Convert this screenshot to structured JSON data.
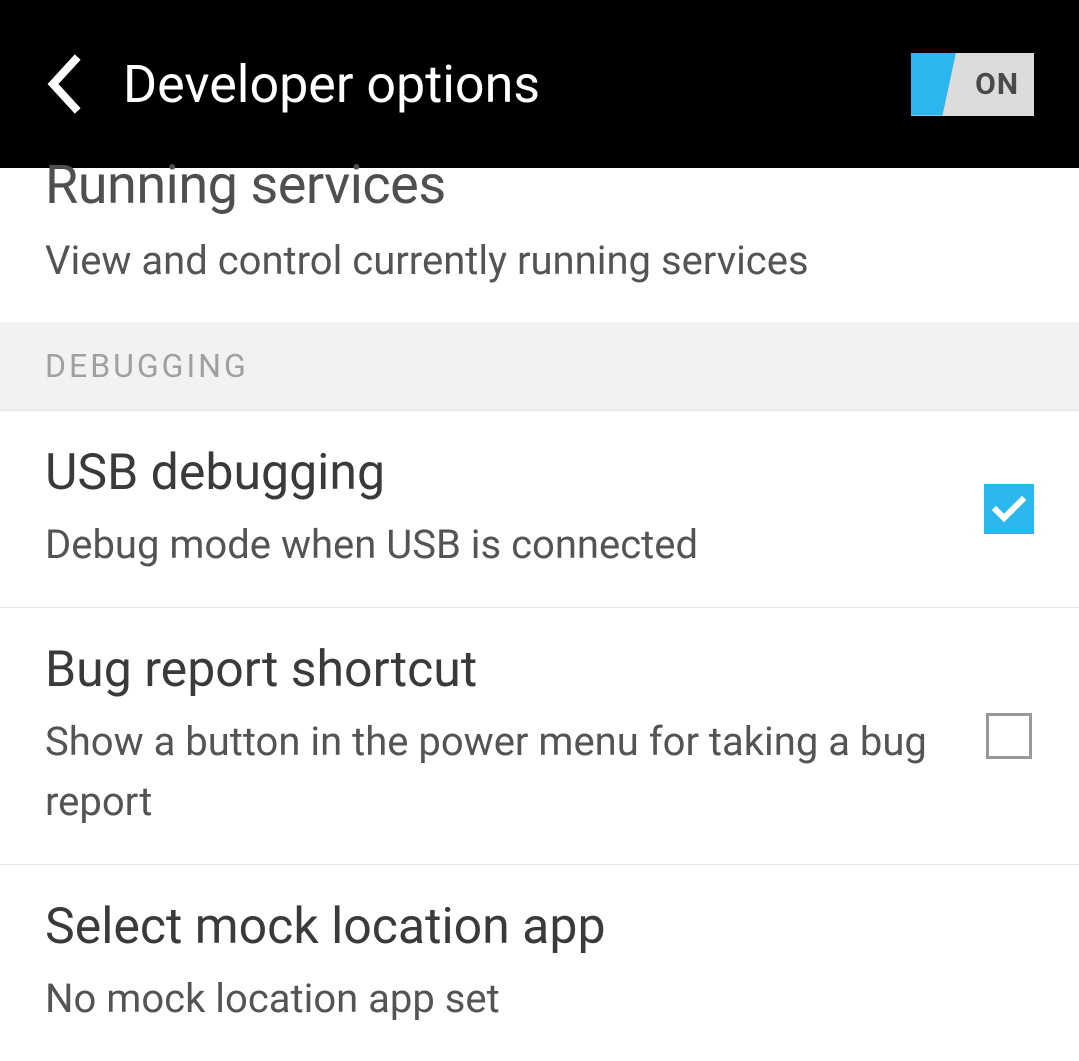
{
  "header": {
    "title": "Developer options",
    "toggle_label": "ON"
  },
  "truncated": {
    "title": "Running services",
    "subtitle": "View and control currently running services"
  },
  "section": {
    "label": "DEBUGGING"
  },
  "items": [
    {
      "title": "USB debugging",
      "subtitle": "Debug mode when USB is connected",
      "checked": true
    },
    {
      "title": "Bug report shortcut",
      "subtitle": "Show a button in the power menu for taking a bug report",
      "checked": false
    },
    {
      "title": "Select mock location app",
      "subtitle": "No mock location app set",
      "checked": null
    }
  ]
}
